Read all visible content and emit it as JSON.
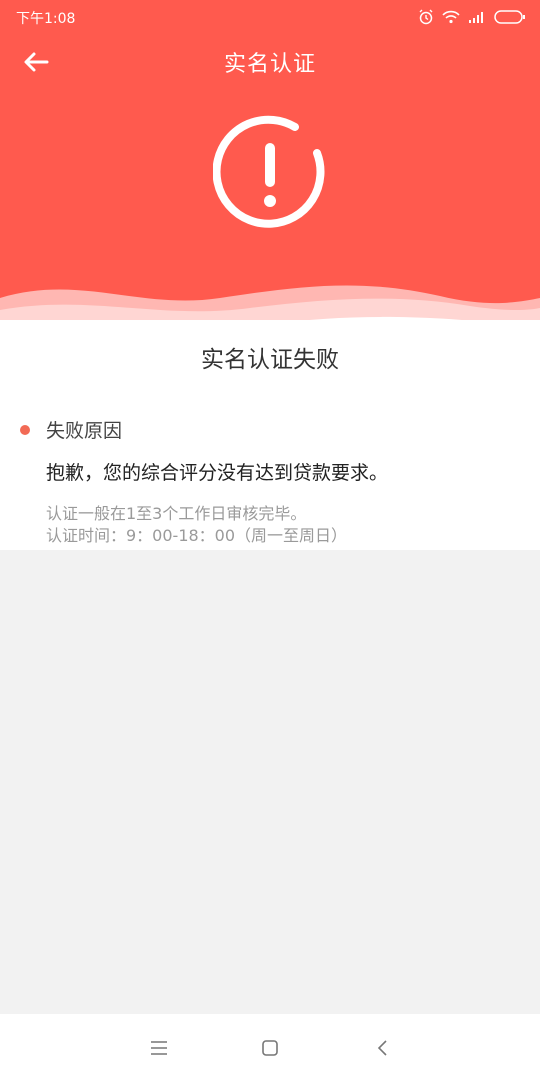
{
  "status_bar": {
    "time": "下午1:08"
  },
  "header": {
    "title": "实名认证",
    "back_icon": "back-arrow-icon",
    "alert_icon": "exclamation-circle-icon"
  },
  "result": {
    "status_title": "实名认证失败"
  },
  "reason": {
    "label": "失败原因",
    "message": "抱歉，您的综合评分没有达到贷款要求。",
    "note_line1": "认证一般在1至3个工作日审核完毕。",
    "note_line2": "认证时间：9：00-18：00（周一至周日）"
  },
  "colors": {
    "primary": "#ff5a4e",
    "dot": "#f26a55",
    "background": "#f2f2f2"
  },
  "nav": {
    "menu_icon": "menu-icon",
    "home_icon": "home-square-icon",
    "back_icon": "back-chevron-icon"
  }
}
